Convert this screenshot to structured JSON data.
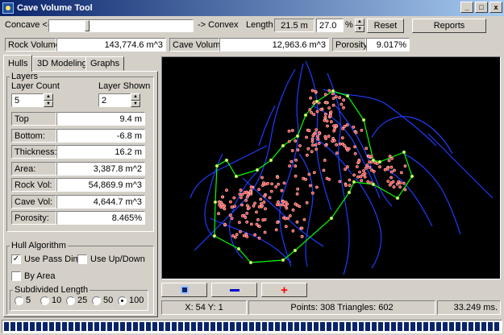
{
  "window": {
    "title": "Cave Volume Tool",
    "controls": [
      "_",
      "□",
      "x"
    ]
  },
  "toolbar": {
    "concave_label": "Concave <-",
    "convex_label": "-> Convex",
    "length_label": "Length",
    "length_display": "21.5 m",
    "length_input": "27.0",
    "percent_symbol": "%",
    "reset_label": "Reset",
    "reports_label": "Reports"
  },
  "stats": {
    "rock_volume_label": "Rock Volume:",
    "rock_volume_value": "143,774.6 m^3",
    "cave_volume_label": "Cave Volume:",
    "cave_volume_value": "12,963.6 m^3",
    "porosity_label": "Porosity:",
    "porosity_value": "9.017%"
  },
  "tabs": [
    {
      "label": "Hulls",
      "active": true
    },
    {
      "label": "3D Modeling",
      "active": false
    },
    {
      "label": "Graphs",
      "active": false
    }
  ],
  "layers": {
    "group_title": "Layers",
    "layer_count_label": "Layer Count",
    "layer_count_value": "5",
    "layer_shown_label": "Layer Shown",
    "layer_shown_value": "2",
    "properties": [
      {
        "label": "Top",
        "value": "9.4 m"
      },
      {
        "label": "Bottom:",
        "value": "-6.8 m"
      },
      {
        "label": "Thickness:",
        "value": "16.2 m"
      },
      {
        "label": "Area:",
        "value": "3,387.8 m^2"
      },
      {
        "label": "Rock Vol:",
        "value": "54,869.9 m^3"
      },
      {
        "label": "Cave Vol:",
        "value": "4,644.7 m^3"
      },
      {
        "label": "Porosity:",
        "value": "8.465%"
      }
    ]
  },
  "hull_algorithm": {
    "group_title": "Hull Algorithm",
    "use_pass_dims": {
      "label": "Use Pass Dims",
      "checked": true
    },
    "use_up_down": {
      "label": "Use Up/Down",
      "checked": false
    },
    "by_area": {
      "label": "By Area",
      "checked": false
    },
    "subdivided_title": "Subdivided Length",
    "options": [
      {
        "label": "5",
        "selected": false
      },
      {
        "label": "10",
        "selected": false
      },
      {
        "label": "25",
        "selected": false
      },
      {
        "label": "50",
        "selected": false
      },
      {
        "label": "100",
        "selected": true
      }
    ]
  },
  "view_buttons": {
    "fit_icon": "fit-view-icon",
    "zoom_out_icon": "minus-icon",
    "zoom_in_icon": "plus-icon"
  },
  "status": {
    "cursor": "X: 54 Y: 1",
    "counts": "Points: 308  Triangles: 602",
    "timing": "33.249 ms."
  },
  "colors": {
    "titlebar": "#0a246a",
    "hull": "#00ff00",
    "passages": "#1e3cff",
    "points": "#ff4040",
    "zoom_in": "#ff0000",
    "zoom_out": "#0000cc"
  }
}
